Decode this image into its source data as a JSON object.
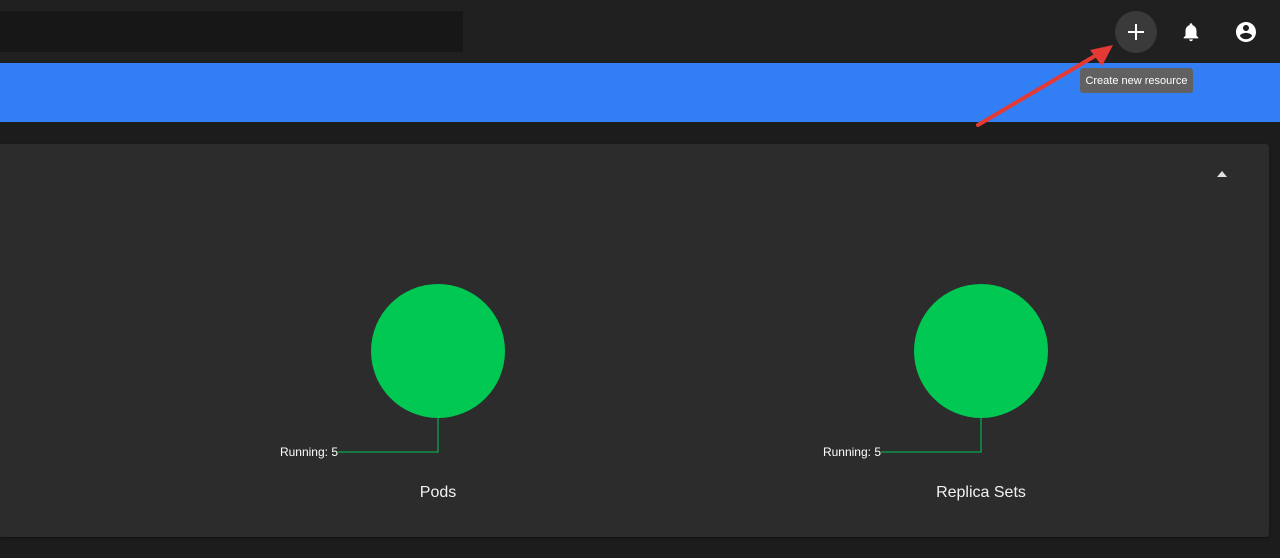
{
  "header": {
    "create_tooltip": "Create new resource",
    "icons": [
      "plus-icon",
      "bell-icon",
      "account-circle-icon"
    ]
  },
  "card": {
    "collapse_icon": "arrow-up-icon"
  },
  "chart_data": [
    {
      "type": "pie",
      "title": "Pods",
      "slices": [
        {
          "label": "Running",
          "value": 5,
          "color": "#00c853"
        }
      ],
      "label_text": "Running: 5"
    },
    {
      "type": "pie",
      "title": "Replica Sets",
      "slices": [
        {
          "label": "Running",
          "value": 5,
          "color": "#00c853"
        }
      ],
      "label_text": "Running: 5"
    }
  ],
  "colors": {
    "accent": "#327ef4",
    "running": "#00c853",
    "annotation_arrow": "#e53935"
  }
}
